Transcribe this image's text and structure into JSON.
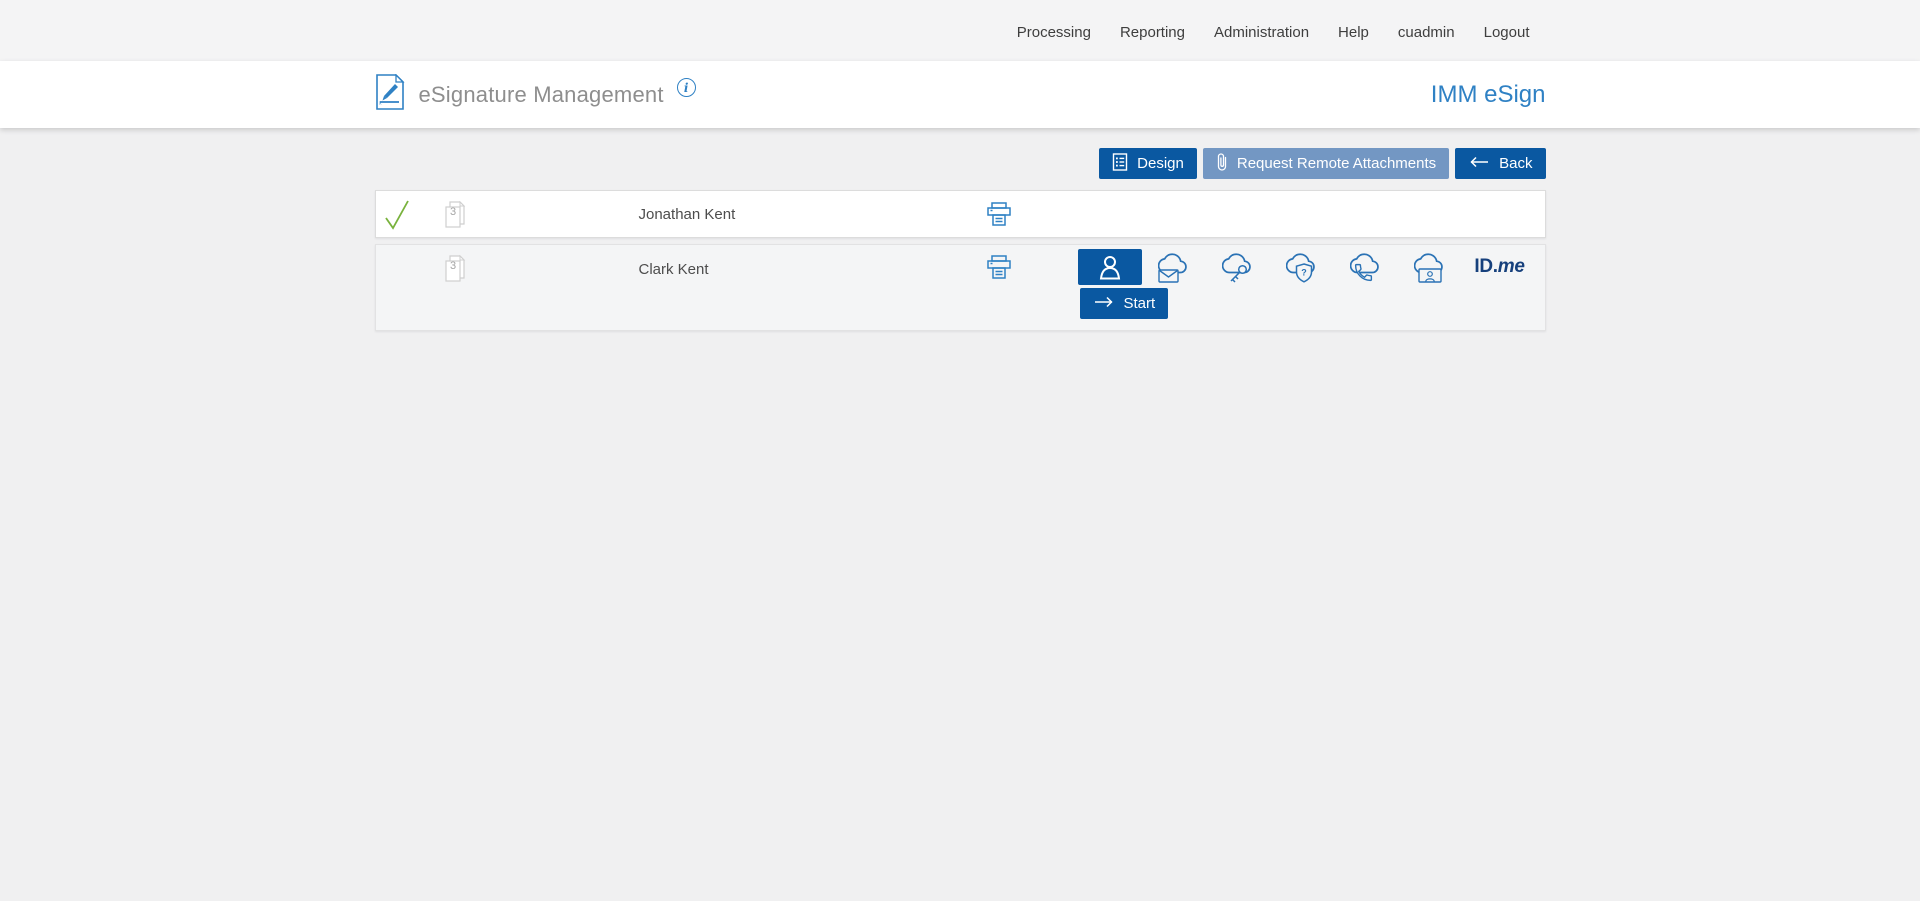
{
  "topnav": {
    "items": [
      "Processing",
      "Reporting",
      "Administration",
      "Help",
      "cuadmin",
      "Logout"
    ]
  },
  "header": {
    "title": "eSignature Management",
    "brand": "IMM eSign"
  },
  "icons": {
    "info_glyph": "i"
  },
  "toolbar": {
    "design": "Design",
    "request_remote_attachments": "Request Remote Attachments",
    "back": "Back"
  },
  "signers": [
    {
      "name": "Jonathan Kent",
      "document_count": "3",
      "signed": true
    },
    {
      "name": "Clark Kent",
      "document_count": "3",
      "signed": false,
      "selected_method": "in-person-signer",
      "methods": [
        "in-person-signer",
        "remote-email",
        "remote-access-code",
        "remote-security-question",
        "remote-phone",
        "remote-photo-id",
        "idme"
      ],
      "shield_mark": "?",
      "idme": {
        "bold": "ID.",
        "italic": "me"
      },
      "start": "Start"
    }
  ],
  "colors": {
    "primary_blue": "#0a58a1",
    "muted_blue": "#7397c3",
    "icon_blue": "#2a72b5",
    "brand_blue": "#2f81c4",
    "check_green": "#79b23d",
    "page_bg": "#f0f0f1",
    "topbar_bg": "#f4f4f5",
    "row_alt_bg": "#f4f5f6",
    "idme_navy": "#16407c"
  }
}
